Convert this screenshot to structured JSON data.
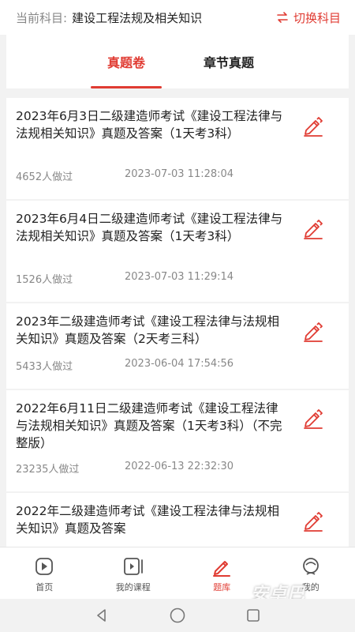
{
  "subject": {
    "prefix": "当前科目:",
    "name": "建设工程法规及相关知识",
    "switch_label": "切换科目"
  },
  "tabs": [
    {
      "label": "真题卷",
      "active": true
    },
    {
      "label": "章节真题",
      "active": false
    }
  ],
  "papers": [
    {
      "title": "2023年6月3日二级建造师考试《建设工程法律与法规相关知识》真题及答案（1天考3科）",
      "count": "4652人做过",
      "date": "2023-07-03 11:28:04"
    },
    {
      "title": "2023年6月4日二级建造师考试《建设工程法律与法规相关知识》真题及答案（1天考3科）",
      "count": "1526人做过",
      "date": "2023-07-03 11:29:14"
    },
    {
      "title": "2023年二级建造师考试《建设工程法律与法规相关知识》真题及答案（2天考三科）",
      "count": "5433人做过",
      "date": "2023-06-04 17:54:56"
    },
    {
      "title": "2022年6月11日二级建造师考试《建设工程法律与法规相关知识》真题及答案（1天考3科）（不完整版）",
      "count": "23235人做过",
      "date": "2022-06-13 22:32:30"
    },
    {
      "title": "2022年二级建造师考试《建设工程法律与法规相关知识》真题及答案",
      "count": "",
      "date": ""
    }
  ],
  "tabbar": [
    {
      "label": "首页",
      "icon": "play-icon"
    },
    {
      "label": "我的课程",
      "icon": "course-icon"
    },
    {
      "label": "题库",
      "icon": "pen-icon"
    },
    {
      "label": "我的",
      "icon": "profile-icon"
    }
  ],
  "watermark": "安卓巴",
  "colors": {
    "accent": "#e03b32",
    "background": "#f2f2f2"
  }
}
